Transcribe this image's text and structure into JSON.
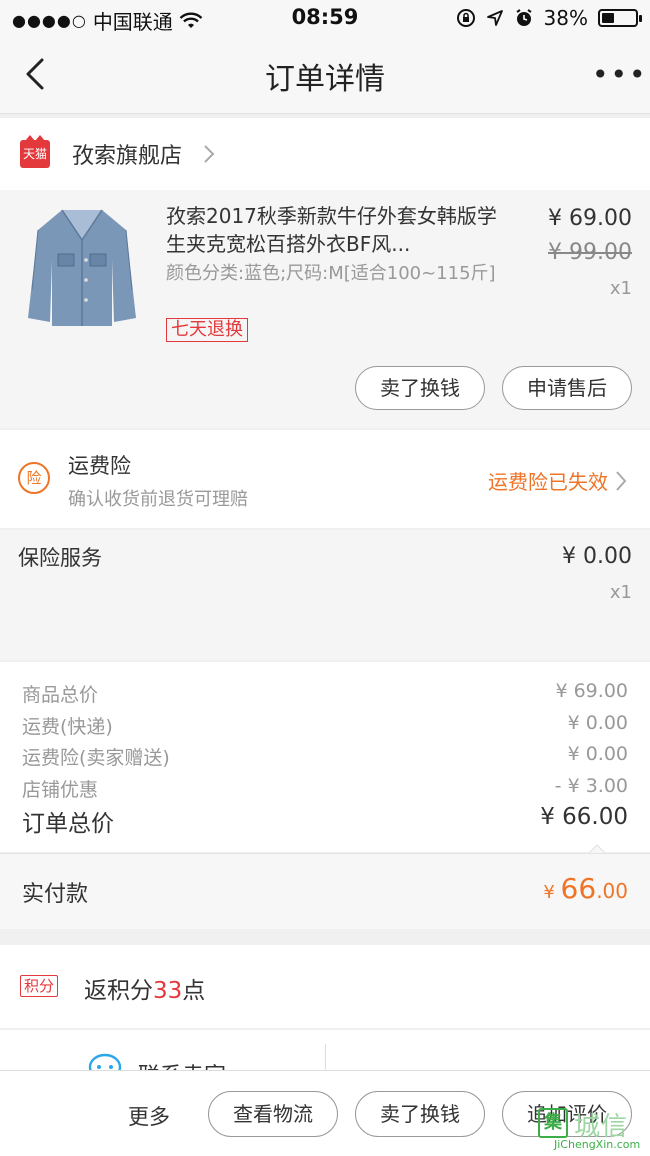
{
  "status_bar": {
    "signal": "●●●●○",
    "carrier": "中国联通",
    "time": "08:59",
    "battery": "38%",
    "battery_level": 0.38
  },
  "nav": {
    "title": "订单详情",
    "more": "•••"
  },
  "shop": {
    "badge": "天猫",
    "name": "孜索旗舰店"
  },
  "item": {
    "title": "孜索2017秋季新款牛仔外套女韩版学生夹克宽松百搭外衣BF风...",
    "spec": "颜色分类:蓝色;尺码:M[适合100~115斤]",
    "tag": "七天退换",
    "price": "¥ 69.00",
    "original_price": "¥ 99.00",
    "quantity": "x1",
    "actions": [
      "卖了换钱",
      "申请售后"
    ]
  },
  "insurance": {
    "icon_text": "险",
    "title": "运费险",
    "subtitle": "确认收货前退货可理赔",
    "status": "运费险已失效"
  },
  "service": {
    "title": "保险服务",
    "price": "¥ 0.00",
    "quantity": "x1"
  },
  "summary": {
    "rows": [
      {
        "label": "商品总价",
        "value": "¥ 69.00"
      },
      {
        "label": "运费(快递)",
        "value": "¥ 0.00"
      },
      {
        "label": "运费险(卖家赠送)",
        "value": "¥ 0.00"
      },
      {
        "label": "店铺优惠",
        "value": "- ¥ 3.00"
      }
    ],
    "total_label": "订单总价",
    "total_value": "¥ 66.00"
  },
  "paid": {
    "label": "实付款",
    "currency": "¥ ",
    "integer": "66",
    "decimal": ".00"
  },
  "points": {
    "badge": "积分",
    "prefix": "返积分",
    "number": "33",
    "suffix": "点"
  },
  "contact": {
    "label": "联系卖家"
  },
  "bottom_bar": {
    "more": "更多",
    "buttons": [
      "查看物流",
      "卖了换钱",
      "追加评价"
    ]
  },
  "watermark": {
    "box": "集",
    "text": "城信",
    "url": "JiChengXin.com"
  },
  "colors": {
    "accent_orange": "#f07427",
    "tmall_red": "#e4393c"
  }
}
